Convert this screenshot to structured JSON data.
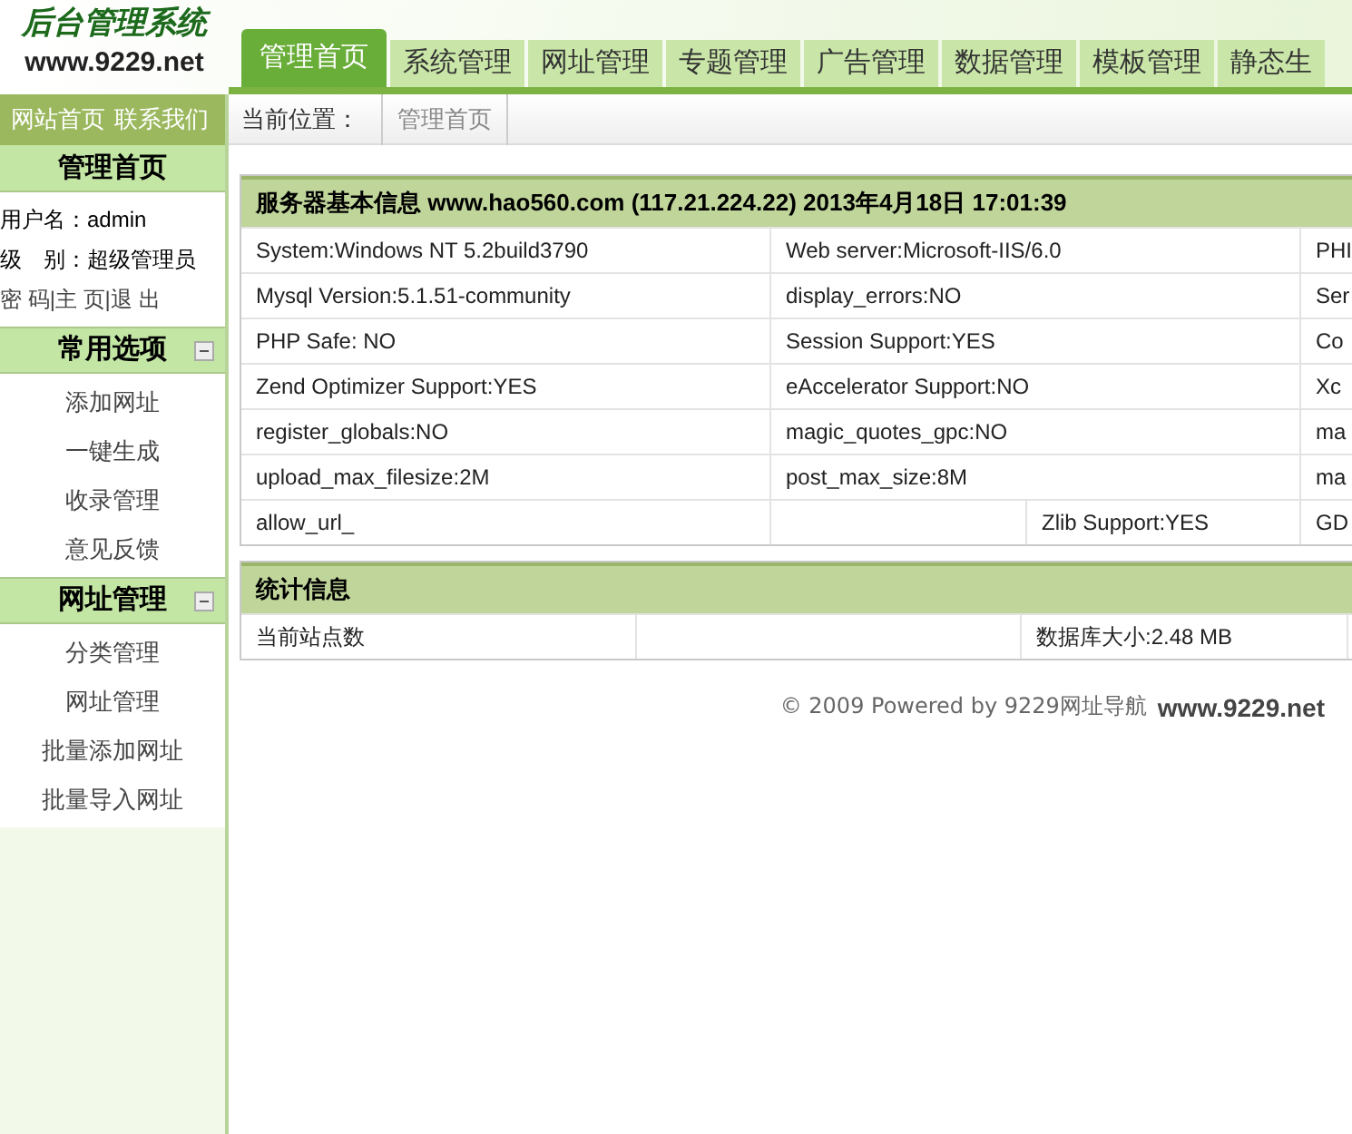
{
  "logo": {
    "title": "后台管理系统",
    "url": "www.9229.net"
  },
  "tabs": [
    {
      "label": "管理首页",
      "selected": true
    },
    {
      "label": "系统管理",
      "selected": false
    },
    {
      "label": "网址管理",
      "selected": false
    },
    {
      "label": "专题管理",
      "selected": false
    },
    {
      "label": "广告管理",
      "selected": false
    },
    {
      "label": "数据管理",
      "selected": false
    },
    {
      "label": "模板管理",
      "selected": false
    },
    {
      "label": "静态生",
      "selected": false
    }
  ],
  "top_links": [
    "网站首页",
    "联系我们"
  ],
  "breadcrumb": {
    "label": "当前位置：",
    "items": [
      "管理首页"
    ]
  },
  "sidebar": {
    "title": "管理首页",
    "user": [
      {
        "label": "用户名：",
        "value": "admin"
      },
      {
        "label": "级　别：",
        "value": "超级管理员"
      }
    ],
    "links": [
      "密 码",
      "|主 页|",
      "退 出"
    ],
    "sections": [
      {
        "title": "常用选项",
        "expanded": true,
        "items": [
          "添加网址",
          "一键生成",
          "收录管理",
          "意见反馈"
        ]
      },
      {
        "title": "网址管理",
        "expanded": true,
        "items": [
          "分类管理",
          "网址管理",
          "批量添加网址",
          "批量导入网址"
        ]
      }
    ]
  },
  "server_info": {
    "title": "服务器基本信息 www.hao560.com (117.21.224.22)  2013年4月18日 17:01:39",
    "rows": [
      [
        "System:Windows NT 5.2build3790",
        "Web server:Microsoft-IIS/6.0",
        "PHI"
      ],
      [
        "Mysql Version:5.1.51-community",
        "display_errors:NO",
        "Ser"
      ],
      [
        "PHP Safe: NO",
        "Session Support:YES",
        "Co"
      ],
      [
        "Zend Optimizer Support:YES",
        "eAccelerator Support:NO",
        "Xc"
      ],
      [
        "register_globals:NO",
        "magic_quotes_gpc:NO",
        "ma"
      ],
      [
        "upload_max_filesize:2M",
        "post_max_size:8M",
        "ma"
      ],
      [
        "allow_url_",
        "Zlib Support:YES",
        "GD"
      ]
    ]
  },
  "stats": {
    "title": "统计信息",
    "rows": [
      [
        "当前站点数",
        "",
        "数据库大小:2.48 MB"
      ]
    ]
  },
  "footer": {
    "text": "© 2009 Powered by 9229网址导航",
    "link": "www.9229.net"
  }
}
